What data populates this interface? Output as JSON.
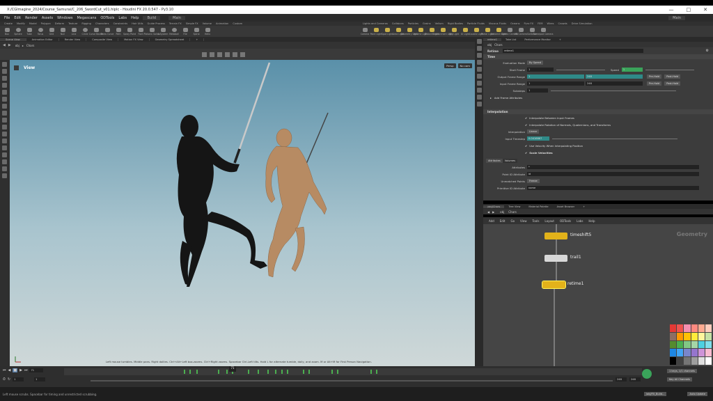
{
  "titlebar": {
    "title": "X:/CGImagine_2024/Course_Samurai/C_206_SwordCut_v01.hiplc - Houdini FX 20.0.547 - Py3.10"
  },
  "menu": {
    "items": [
      "File",
      "Edit",
      "Render",
      "Assets",
      "Windows",
      "Megascans",
      "ODTools",
      "Labs",
      "Help"
    ],
    "desktop_left": "Build",
    "desktop_mid": "Main",
    "desktop_right": "Main"
  },
  "shelf_tabs_left": [
    "Create",
    "Modify",
    "Model",
    "Polygon",
    "Deform",
    "Texture",
    "Rigging",
    "Characters",
    "Constraints",
    "Hair Utils",
    "Guide Process",
    "Terrain FX",
    "Simple FX",
    "Volume",
    "Animation",
    "Custom"
  ],
  "shelf_tabs_right": [
    "Lights and Cameras",
    "Collisions",
    "Particles",
    "Grains",
    "Vellum",
    "Rigid Bodies",
    "Particle Fluids",
    "Viscous Fluids",
    "Oceans",
    "Pyro FX",
    "FEM",
    "Wires",
    "Crowds",
    "Drive Simulation"
  ],
  "shelf_tools_left": [
    "Box",
    "Sphere",
    "Tube",
    "Torus",
    "Grid",
    "Null",
    "Line",
    "Circle",
    "Curve Bezier",
    "Draw Curve",
    "Path",
    "Spray Paint",
    "Font",
    "Platonic Solids",
    "L-System",
    "Metaball",
    "File",
    "Spiral",
    "Helix"
  ],
  "shelf_tools_right": [
    "Camera",
    "Point Light",
    "Spot Light",
    "Area Light",
    "Geometry Light",
    "Volume Light",
    "Distant Light",
    "Environment Light",
    "Sky Light",
    "GI Light",
    "Caustic Light",
    "Portal Light",
    "Ambient Light",
    "Stereo Camera",
    "VR Camera",
    "Switcher",
    "Gamepad Camera"
  ],
  "panel_tabs": [
    "Scene View",
    "Animation Editor",
    "Render View",
    "Composite View",
    "Motion FX View",
    "Geometry Spreadsheet"
  ],
  "viewport": {
    "path_obj": "obj",
    "path_node": "Chars",
    "label": "View",
    "persp": "Persp",
    "cam": "No cam",
    "hint": "Left mouse tumbles. Middle pans. Right dollies. Ctrl+Alt+Left box-zooms. Ctrl+Right zooms. Spacebar Ctrl-Left tilts. Hold L for alternate tumble, dolly, and zoom. M or Alt+M for First Person Navigation."
  },
  "param_tabs": [
    "retime1",
    "Take List",
    "Performance Monitor"
  ],
  "param_path": {
    "obj": "obj",
    "node": "Chars"
  },
  "params": {
    "node_type": "Retime",
    "node_name": "retime1",
    "section_time": "Time",
    "evaluation_mode_label": "Evaluation Mode",
    "evaluation_mode": "By Speed",
    "start_frame_label": "Start Frame",
    "start_frame": "1",
    "speed_label": "Speed",
    "speed": "1",
    "output_range_label": "Output Frame Range",
    "output_start": "1",
    "output_end": "248",
    "input_range_label": "Input Frame Range",
    "input_start": "1",
    "input_end": "248",
    "prehold": "Pre-Hold",
    "posthold": "Post-Hold",
    "substeps_label": "Substeps",
    "substeps": "1",
    "add_frame_attributes": "Add Frame Attributes",
    "section_interp": "Interpolation",
    "interp_frames": "Interpolate Between Input Frames",
    "interp_rotation": "Interpolate Rotation of Normals, Quaternions, and Transforms",
    "interpolation_label": "Interpolation",
    "interpolation": "Linear",
    "input_timestep_label": "Input Timestep",
    "input_timestep": "0.0416667",
    "use_velocity": "Use Velocity When Interpolating Position",
    "scale_velocities": "Scale Velocities",
    "tab_attributes": "Attributes",
    "tab_volumes": "Volumes",
    "attributes_label": "Attributes",
    "attributes": "*",
    "point_id_label": "Point ID Attribute",
    "point_id": "id",
    "unmatched_label": "Unmatched Points",
    "unmatched": "Freeze",
    "prim_id_label": "Primitive ID Attribute",
    "prim_id": "name"
  },
  "network_tabs": [
    "/obj/Chars",
    "Tree View",
    "Material Palette",
    "Asset Browser"
  ],
  "network_path": {
    "obj": "obj",
    "node": "Chars"
  },
  "network_menu": [
    "Add",
    "Edit",
    "Go",
    "View",
    "Tools",
    "Layout",
    "ODTools",
    "Labs",
    "Help"
  ],
  "network": {
    "context": "Geometry",
    "nodes": [
      "timeshift5",
      "trail1",
      "retime1"
    ],
    "colors": {
      "yellow": "#e2b21a",
      "white": "#d8d8d8"
    }
  },
  "timeline": {
    "current_frame": "71",
    "start": "1",
    "start2": "1",
    "end": "248",
    "end2": "248",
    "keys_info": "1 keys, 1/1 channels",
    "key_all": "Key All Channels",
    "auto_update": "Auto Update",
    "tick_labels": [
      "24",
      "48",
      "72",
      "96",
      "120",
      "144",
      "168",
      "192",
      "216",
      "240"
    ]
  },
  "statusbar": {
    "text": "Left mouse scrubs. Spacebar for timing and unrestricted scrubbing.",
    "task": "/obj/FX_Build...",
    "update_mode": "Auto Update"
  },
  "accent": "#3aa3a0"
}
